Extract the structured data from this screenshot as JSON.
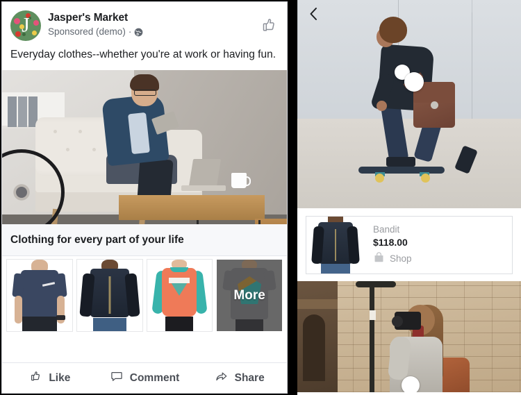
{
  "post": {
    "page_name": "Jasper's Market",
    "sponsored_label": "Sponsored (demo)",
    "separator_dot": "·",
    "audience_icon": "globe-icon",
    "like_icon": "thumbs-up-icon",
    "body_text": "Everyday clothes--whether you're at work or having fun.",
    "avatar_letter": "J",
    "card_title": "Clothing for every part of your life",
    "thumbnails": [
      {
        "alt": "navy short sleeve shirt",
        "overlay": ""
      },
      {
        "alt": "dark denim jacket",
        "overlay": ""
      },
      {
        "alt": "coral and teal raglan top",
        "overlay": ""
      },
      {
        "alt": "grey graphic tee",
        "overlay": "More"
      }
    ],
    "more_label": "More",
    "actions": [
      {
        "label": "Like",
        "icon": "thumbs-up-icon"
      },
      {
        "label": "Comment",
        "icon": "comment-bubble-icon"
      },
      {
        "label": "Share",
        "icon": "share-arrow-icon"
      }
    ]
  },
  "canvas": {
    "back_icon": "back-chevron-icon",
    "images": [
      {
        "alt": "man on skateboard wearing blazer with messenger bag"
      },
      {
        "alt": "woman photographing with camera near brick wall"
      }
    ],
    "product": {
      "name": "Bandit",
      "price": "$118.00",
      "shop_label": "Shop",
      "shop_icon": "shopping-bag-icon",
      "thumb_alt": "denim jacket product photo"
    },
    "tag_dots": [
      {
        "name": "product-tag-dot-1"
      },
      {
        "name": "product-tag-dot-2"
      },
      {
        "name": "product-tag-dot-3"
      }
    ]
  },
  "colors": {
    "text_primary": "#1c1e21",
    "text_secondary": "#606770",
    "action_text": "#4b4f56",
    "card_title_bg": "#f7f8fa",
    "border": "#dcdee2",
    "brand_green": "#5f8f5f"
  }
}
